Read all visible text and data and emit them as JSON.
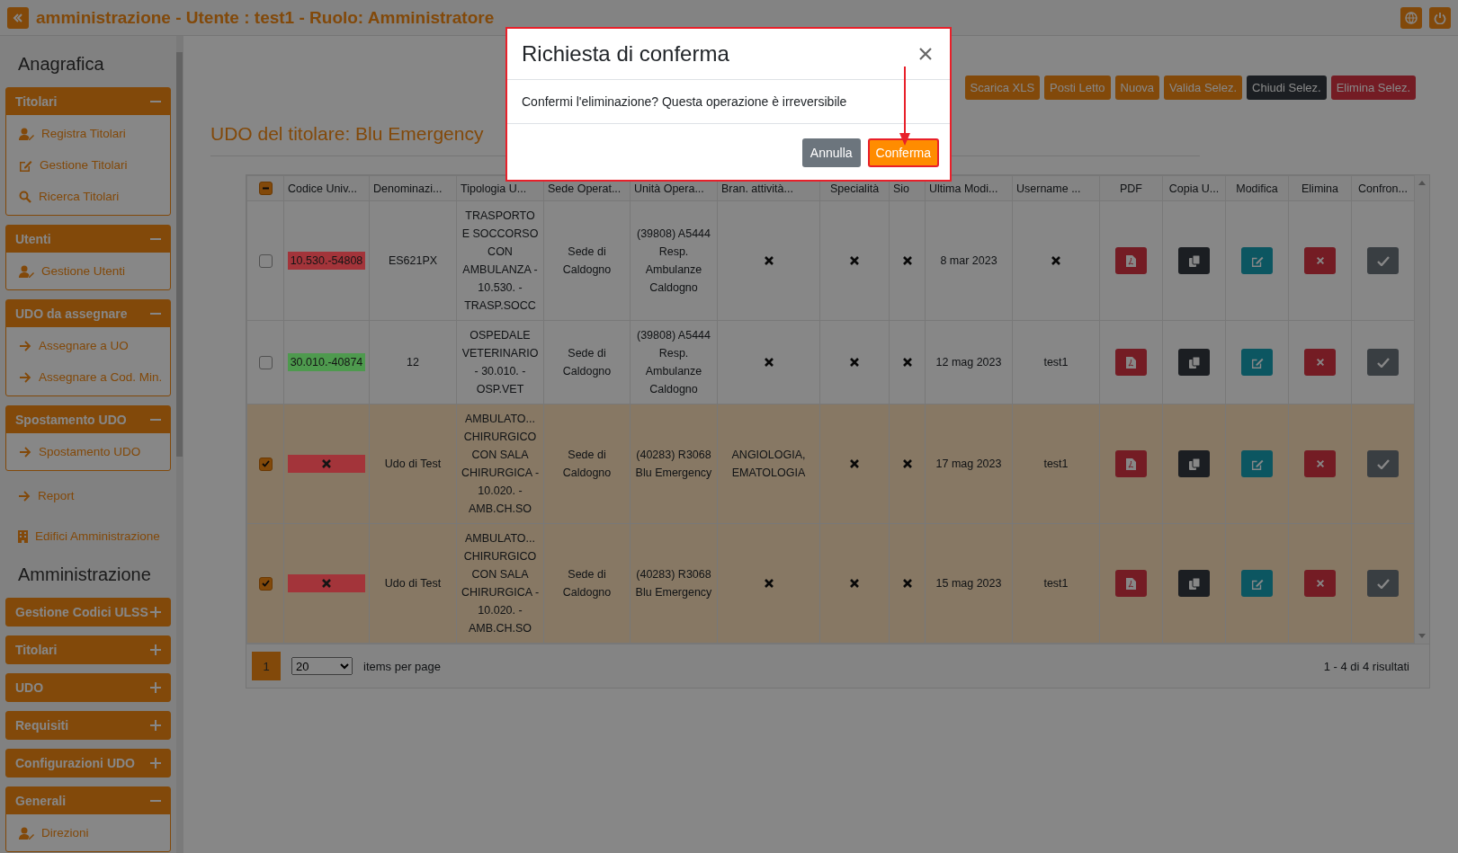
{
  "topbar": {
    "title": "amministrazione - Utente : test1 - Ruolo: Amministratore"
  },
  "sidebar": {
    "sections": [
      {
        "heading": "Anagrafica",
        "groups": [
          {
            "kind": "panel",
            "title": "Titolari",
            "expanded": true,
            "items": [
              {
                "label": "Registra Titolari"
              },
              {
                "label": "Gestione Titolari"
              },
              {
                "label": "Ricerca Titolari"
              }
            ]
          },
          {
            "kind": "panel",
            "title": "Utenti",
            "expanded": true,
            "items": [
              {
                "label": "Gestione Utenti"
              }
            ]
          },
          {
            "kind": "panel",
            "title": "UDO da assegnare",
            "expanded": true,
            "items": [
              {
                "label": "Assegnare a UO"
              },
              {
                "label": "Assegnare a Cod. Min."
              }
            ]
          },
          {
            "kind": "panel",
            "title": "Spostamento UDO",
            "expanded": true,
            "items": [
              {
                "label": "Spostamento UDO"
              }
            ]
          },
          {
            "kind": "link",
            "label": "Report"
          },
          {
            "kind": "link",
            "label": "Edifici Amministrazione"
          }
        ]
      },
      {
        "heading": "Amministrazione",
        "groups": [
          {
            "kind": "panel",
            "title": "Gestione Codici ULSS",
            "expanded": false
          },
          {
            "kind": "panel",
            "title": "Titolari",
            "expanded": false
          },
          {
            "kind": "panel",
            "title": "UDO",
            "expanded": false
          },
          {
            "kind": "panel",
            "title": "Requisiti",
            "expanded": false
          },
          {
            "kind": "panel",
            "title": "Configurazioni UDO",
            "expanded": false
          },
          {
            "kind": "panel",
            "title": "Generali",
            "expanded": true,
            "items": [
              {
                "label": "Direzioni"
              }
            ]
          }
        ]
      }
    ]
  },
  "toolbar": [
    {
      "label": "Scarica XLS",
      "kind": "warning"
    },
    {
      "label": "Posti Letto",
      "kind": "warning"
    },
    {
      "label": "Nuova",
      "kind": "warning"
    },
    {
      "label": "Valida Selez.",
      "kind": "warning"
    },
    {
      "label": "Chiudi Selez.",
      "kind": "dark"
    },
    {
      "label": "Elimina Selez.",
      "kind": "danger"
    }
  ],
  "page_title": "UDO del titolare: Blu Emergency",
  "table": {
    "select_all": {
      "indeterminate": true
    },
    "columns": [
      "Codice Univ...",
      "Denominazi...",
      "Tipologia U...",
      "Sede Operat...",
      "Unità Opera...",
      "Bran. attività...",
      "Specialità",
      "Sio",
      "Ultima Modi...",
      "Username ...",
      "PDF",
      "Copia U...",
      "Modifica",
      "Elimina",
      "Confron..."
    ],
    "rows": [
      {
        "selected": false,
        "cells": [
          {
            "kind": "code",
            "text": "10.530.-54808",
            "color": "#a3343a"
          },
          {
            "kind": "text",
            "text": "ES621PX"
          },
          {
            "kind": "text",
            "text": "TRASPORTO E SOCCORSO CON AMBULANZA - 10.530. - TRASP.SOCC"
          },
          {
            "kind": "text",
            "text": "Sede di Caldogno"
          },
          {
            "kind": "text",
            "text": "(39808) A5444 Resp. Ambulanze Caldogno"
          },
          {
            "kind": "none"
          },
          {
            "kind": "none"
          },
          {
            "kind": "none"
          },
          {
            "kind": "text",
            "text": "8 mar 2023"
          },
          {
            "kind": "none"
          }
        ]
      },
      {
        "selected": false,
        "cells": [
          {
            "kind": "code",
            "text": "30.010.-40874",
            "color": "#4e9a4e"
          },
          {
            "kind": "text",
            "text": "12"
          },
          {
            "kind": "text",
            "text": "OSPEDALE VETERINARIO - 30.010. - OSP.VET"
          },
          {
            "kind": "text",
            "text": "Sede di Caldogno"
          },
          {
            "kind": "text",
            "text": "(39808) A5444 Resp. Ambulanze Caldogno"
          },
          {
            "kind": "none"
          },
          {
            "kind": "none"
          },
          {
            "kind": "none"
          },
          {
            "kind": "text",
            "text": "12 mag 2023"
          },
          {
            "kind": "text",
            "text": "test1"
          }
        ]
      },
      {
        "selected": true,
        "cells": [
          {
            "kind": "code-missing",
            "color": "#a3343a"
          },
          {
            "kind": "text",
            "text": "Udo di Test"
          },
          {
            "kind": "text",
            "text": "AMBULATO... CHIRURGICO CON SALA CHIRURGICA - 10.020. - AMB.CH.SO"
          },
          {
            "kind": "text",
            "text": "Sede di Caldogno"
          },
          {
            "kind": "text",
            "text": "(40283) R3068 Blu Emergency"
          },
          {
            "kind": "text",
            "text": "ANGIOLOGIA, EMATOLOGIA"
          },
          {
            "kind": "none"
          },
          {
            "kind": "none"
          },
          {
            "kind": "text",
            "text": "17 mag 2023"
          },
          {
            "kind": "text",
            "text": "test1"
          }
        ]
      },
      {
        "selected": true,
        "cells": [
          {
            "kind": "code-missing",
            "color": "#a3343a"
          },
          {
            "kind": "text",
            "text": "Udo di Test"
          },
          {
            "kind": "text",
            "text": "AMBULATO... CHIRURGICO CON SALA CHIRURGICA - 10.020. - AMB.CH.SO"
          },
          {
            "kind": "text",
            "text": "Sede di Caldogno"
          },
          {
            "kind": "text",
            "text": "(40283) R3068 Blu Emergency"
          },
          {
            "kind": "none"
          },
          {
            "kind": "none"
          },
          {
            "kind": "none"
          },
          {
            "kind": "text",
            "text": "15 mag 2023"
          },
          {
            "kind": "text",
            "text": "test1"
          }
        ]
      }
    ]
  },
  "pagination": {
    "pages": [
      {
        "label": "1",
        "selected": true
      }
    ],
    "page_size": "20",
    "page_size_label": "items per page",
    "summary": "1 - 4 di 4 risultati"
  },
  "modal": {
    "title": "Richiesta di conferma",
    "message": "Confermi l'eliminazione? Questa operazione è irreversibile",
    "buttons": [
      {
        "label": "Annulla",
        "kind": "secondary",
        "highlighted": false
      },
      {
        "label": "Conferma",
        "kind": "primary",
        "highlighted": true
      }
    ]
  }
}
